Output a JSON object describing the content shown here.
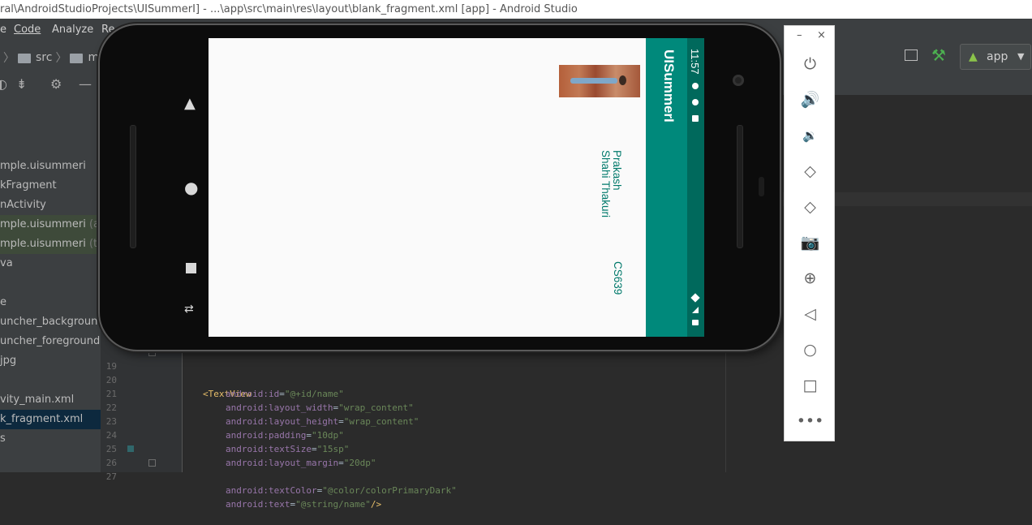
{
  "window": {
    "title": "ral\\AndroidStudioProjects\\UISummerI] - ...\\app\\src\\main\\res\\layout\\blank_fragment.xml [app] - Android Studio"
  },
  "menu": {
    "items": [
      "e",
      "Code",
      "Analyze",
      "Re"
    ]
  },
  "breadcrumb": {
    "items": [
      "src",
      "ma"
    ]
  },
  "run_config": {
    "label": "app"
  },
  "project_tree": {
    "items": [
      {
        "text": "mple.uisummeri",
        "suffix": ""
      },
      {
        "text": "kFragment",
        "suffix": ""
      },
      {
        "text": "nActivity",
        "suffix": ""
      },
      {
        "text": "mple.uisummeri",
        "suffix": " (an"
      },
      {
        "text": "mple.uisummeri",
        "suffix": " (tes"
      },
      {
        "text": "va",
        "suffix": ""
      },
      {
        "text": "e",
        "suffix": ""
      },
      {
        "text": "uncher_background",
        "suffix": ""
      },
      {
        "text": "uncher_foreground.x",
        "suffix": ""
      },
      {
        "text": "jpg",
        "suffix": ""
      },
      {
        "text": "vity_main.xml",
        "suffix": ""
      },
      {
        "text": "k_fragment.xml",
        "suffix": ""
      },
      {
        "text": "s",
        "suffix": ""
      }
    ]
  },
  "editor": {
    "lines": [
      {
        "num": "19",
        "tag": "<TextView",
        "attr": "",
        "value": "",
        "tail": ""
      },
      {
        "num": "20",
        "tag": "",
        "attr": "android:id",
        "value": "\"@+id/name\"",
        "tail": ""
      },
      {
        "num": "21",
        "tag": "",
        "attr": "android:layout_width",
        "value": "\"wrap_content\"",
        "tail": ""
      },
      {
        "num": "22",
        "tag": "",
        "attr": "android:layout_height",
        "value": "\"wrap_content\"",
        "tail": ""
      },
      {
        "num": "23",
        "tag": "",
        "attr": "android:padding",
        "value": "\"10dp\"",
        "tail": ""
      },
      {
        "num": "24",
        "tag": "",
        "attr": "android:textSize",
        "value": "\"15sp\"",
        "tail": ""
      },
      {
        "num": "25",
        "tag": "",
        "attr": "android:layout_margin",
        "value": "\"20dp\"",
        "tail": ""
      },
      {
        "num": "26",
        "tag": "",
        "attr": "android:textColor",
        "value": "\"@color/colorPrimaryDark\"",
        "tail": ""
      },
      {
        "num": "27",
        "tag": "",
        "attr": "android:text",
        "value": "\"@string/name\"",
        "tail": "/>"
      }
    ]
  },
  "device": {
    "app_title": "UISummerI",
    "status_time": "11:57",
    "name_line1": "Prakash",
    "name_line2": "Shahi Thakuri",
    "course": "CS639"
  },
  "emulator_toolbar": {
    "minimize": "–",
    "close": "×",
    "tools": [
      "power-icon",
      "volume-up-icon",
      "volume-down-icon",
      "rotate-left-icon",
      "rotate-right-icon",
      "screenshot-icon",
      "zoom-icon",
      "back-icon",
      "home-icon",
      "overview-icon",
      "more-icon"
    ]
  },
  "colors": {
    "primary": "#00897b",
    "primary_dark": "#00695c",
    "text_teal": "#00796b",
    "ide_bg": "#2b2b2b"
  }
}
